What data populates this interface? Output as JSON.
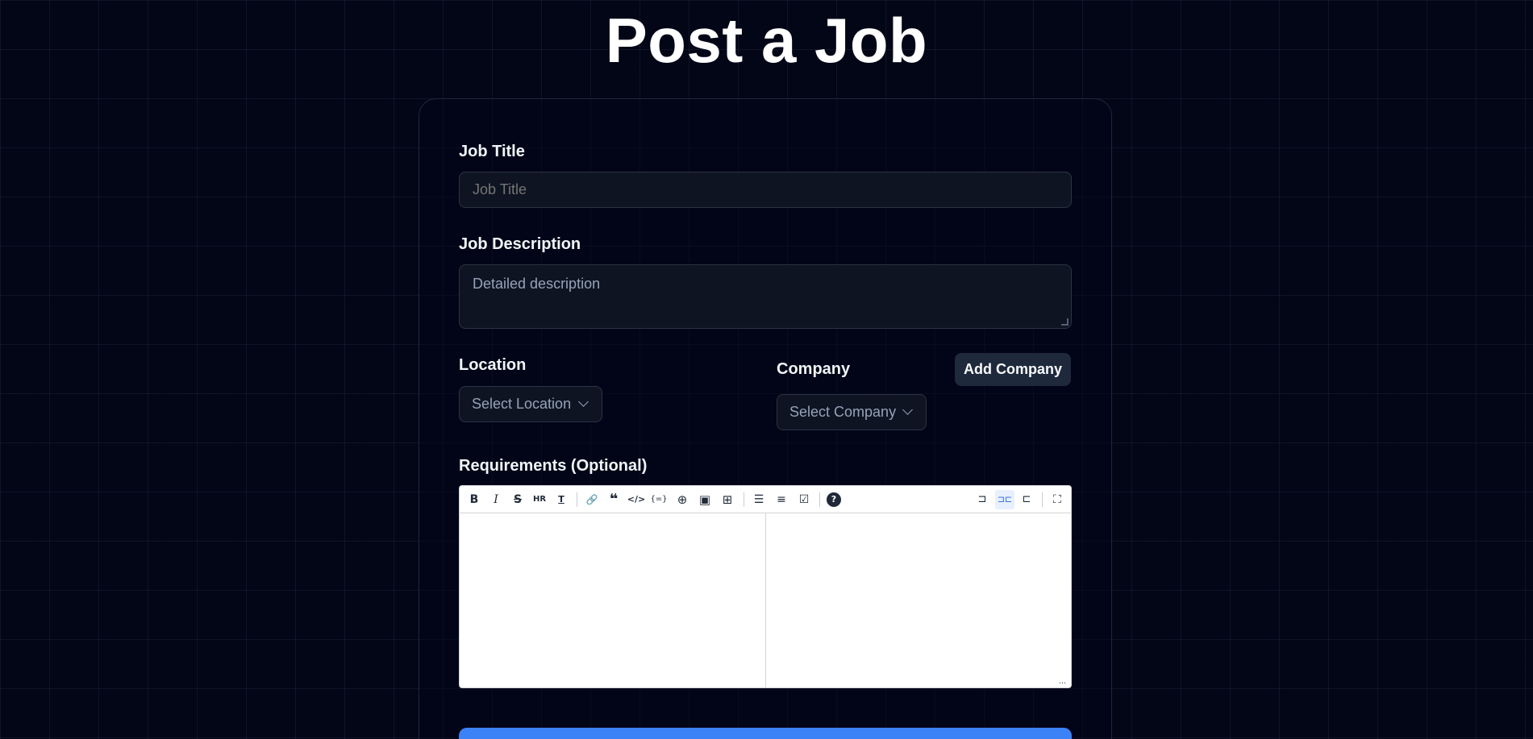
{
  "page": {
    "title": "Post a Job"
  },
  "form": {
    "job_title": {
      "label": "Job Title",
      "placeholder": "Job Title"
    },
    "job_description": {
      "label": "Job Description",
      "placeholder": "Detailed description"
    },
    "location": {
      "label": "Location",
      "select_placeholder": "Select Location"
    },
    "company": {
      "label": "Company",
      "select_placeholder": "Select Company",
      "add_button": "Add Company"
    },
    "requirements": {
      "label": "Requirements (Optional)",
      "toolbar": {
        "bold": "B",
        "italic": "I",
        "strikethrough": "S",
        "hr": "HR",
        "title": "T",
        "link": "🔗",
        "quote": "❝",
        "code": "</>",
        "code_block": "{=}",
        "preview_tip": "⊕",
        "image": "▣",
        "table": "⊞",
        "unordered_list": "☰",
        "ordered_list": "≡",
        "task_list": "☑",
        "help": "?",
        "edit_only": "⊐",
        "split": "⊐⊏",
        "preview_only": "⊏",
        "fullscreen": "⛶"
      },
      "resize_indicator": "..."
    },
    "submit_label": ""
  }
}
